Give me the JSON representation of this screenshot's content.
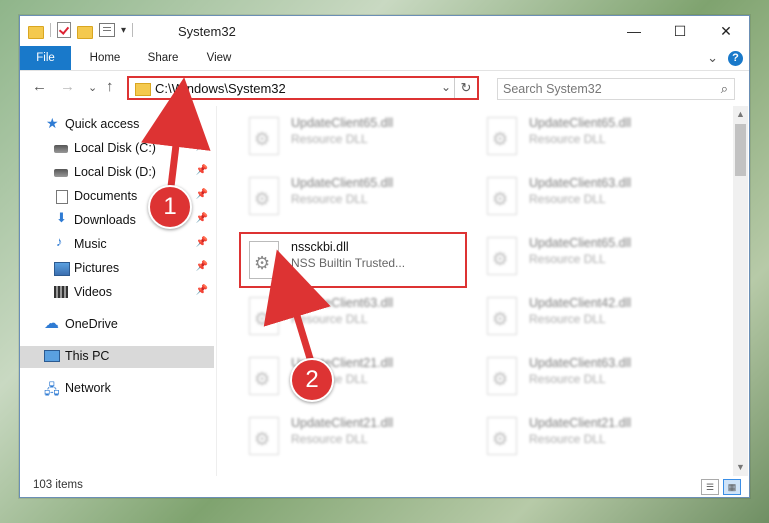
{
  "window": {
    "title": "System32",
    "controls": {
      "minimize": "—",
      "maximize": "☐",
      "close": "✕"
    }
  },
  "ribbon": {
    "tabs": [
      "File",
      "Home",
      "Share",
      "View"
    ],
    "expand_glyph": "⌄",
    "help_glyph": "?"
  },
  "nav": {
    "back": "←",
    "forward": "→",
    "recent": "⌄",
    "up": "↑",
    "address": "C:\\Windows\\System32",
    "address_dropdown": "⌄",
    "refresh": "↻",
    "search_placeholder": "Search System32",
    "search_glyph": "⌕"
  },
  "sidebar": {
    "items": [
      {
        "label": "Quick access",
        "icon": "star-icon",
        "pinned": false
      },
      {
        "label": "Local Disk (C:)",
        "icon": "disk-icon",
        "pinned": true
      },
      {
        "label": "Local Disk (D:)",
        "icon": "disk-icon",
        "pinned": true
      },
      {
        "label": "Documents",
        "icon": "documents-icon",
        "pinned": true
      },
      {
        "label": "Downloads",
        "icon": "downloads-icon",
        "pinned": true
      },
      {
        "label": "Music",
        "icon": "music-icon",
        "pinned": true
      },
      {
        "label": "Pictures",
        "icon": "pictures-icon",
        "pinned": true
      },
      {
        "label": "Videos",
        "icon": "videos-icon",
        "pinned": true
      },
      {
        "label": "OneDrive",
        "icon": "onedrive-icon",
        "pinned": false
      },
      {
        "label": "This PC",
        "icon": "this-pc-icon",
        "pinned": false,
        "selected": true
      },
      {
        "label": "Network",
        "icon": "network-icon",
        "pinned": false
      }
    ],
    "pin_glyph": "📌"
  },
  "files": {
    "left": [
      {
        "name": "UpdateClient65.dll",
        "desc": "Resource DLL"
      },
      {
        "name": "UpdateClient65.dll",
        "desc": "Resource DLL"
      },
      {
        "name": "nssckbi.dll",
        "desc": "NSS Builtin Trusted...",
        "highlight": true
      },
      {
        "name": "UpdateClient63.dll",
        "desc": "Resource DLL"
      },
      {
        "name": "UpdateClient21.dll",
        "desc": "Resource DLL"
      },
      {
        "name": "UpdateClient21.dll",
        "desc": "Resource DLL"
      }
    ],
    "right": [
      {
        "name": "UpdateClient65.dll",
        "desc": "Resource DLL"
      },
      {
        "name": "UpdateClient63.dll",
        "desc": "Resource DLL"
      },
      {
        "name": "UpdateClient65.dll",
        "desc": "Resource DLL"
      },
      {
        "name": "UpdateClient42.dll",
        "desc": "Resource DLL"
      },
      {
        "name": "UpdateClient63.dll",
        "desc": "Resource DLL"
      },
      {
        "name": "UpdateClient21.dll",
        "desc": "Resource DLL"
      }
    ]
  },
  "status": {
    "count": "103 items"
  },
  "annotations": {
    "step1": "1",
    "step2": "2",
    "color": "#dd3333"
  }
}
